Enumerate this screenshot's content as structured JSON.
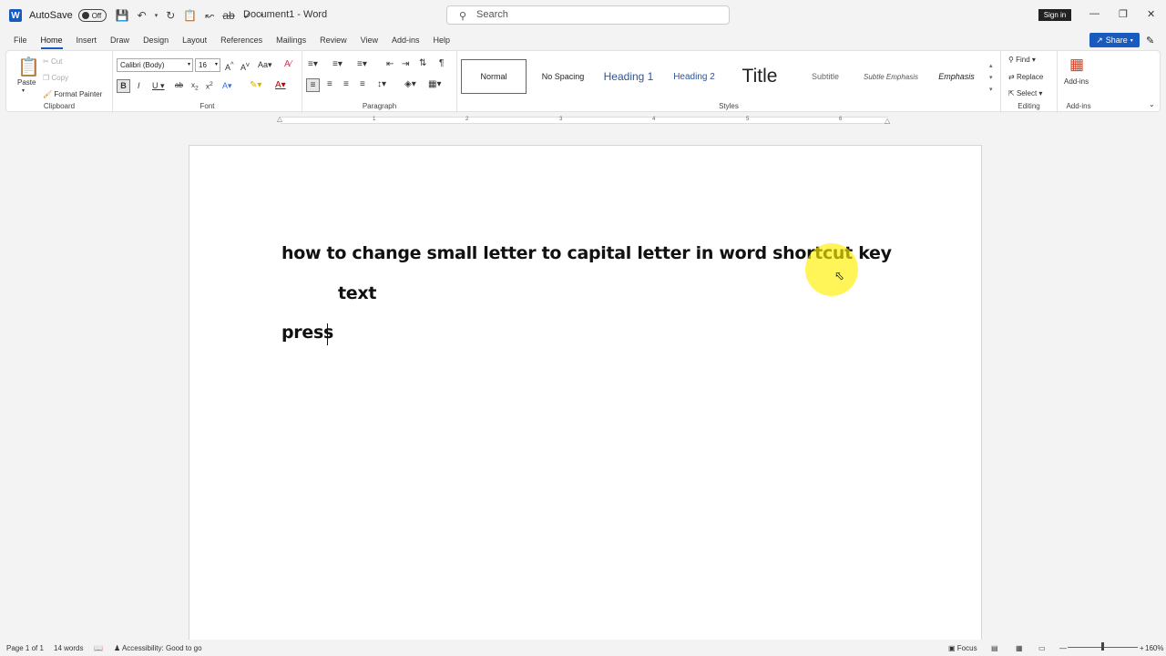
{
  "titlebar": {
    "autosave_label": "AutoSave",
    "autosave_state": "Off",
    "doc_title": "Document1 - Word",
    "search_placeholder": "Search",
    "signin_label": "Sign in"
  },
  "menu": {
    "tabs": [
      "File",
      "Home",
      "Insert",
      "Draw",
      "Design",
      "Layout",
      "References",
      "Mailings",
      "Review",
      "View",
      "Add-ins",
      "Help"
    ],
    "active_tab": "Home",
    "share_label": "Share"
  },
  "ribbon": {
    "clipboard": {
      "paste": "Paste",
      "cut": "Cut",
      "copy": "Copy",
      "format_painter": "Format Painter",
      "label": "Clipboard"
    },
    "font": {
      "name": "Calibri (Body)",
      "size": "16",
      "label": "Font"
    },
    "paragraph": {
      "label": "Paragraph"
    },
    "styles": {
      "items": [
        "Normal",
        "No Spacing",
        "Heading 1",
        "Heading 2",
        "Title",
        "Subtitle",
        "Subtle Emphasis",
        "Emphasis"
      ],
      "label": "Styles"
    },
    "editing": {
      "find": "Find",
      "replace": "Replace",
      "select": "Select",
      "label": "Editing"
    },
    "addins": {
      "addins": "Add-ins",
      "label": "Add-ins"
    }
  },
  "ruler": {
    "numbers": [
      "1",
      "1",
      "2",
      "3",
      "4",
      "5",
      "6"
    ]
  },
  "document": {
    "line1": "how to change small letter to capital letter in word shortcut key",
    "line2": "text",
    "line3": "press"
  },
  "status": {
    "page": "Page 1 of 1",
    "words": "14 words",
    "accessibility": "Accessibility: Good to go",
    "focus": "Focus",
    "zoom": "160%"
  },
  "colors": {
    "accent": "#185abd",
    "cursor_highlight": "#fff000"
  }
}
